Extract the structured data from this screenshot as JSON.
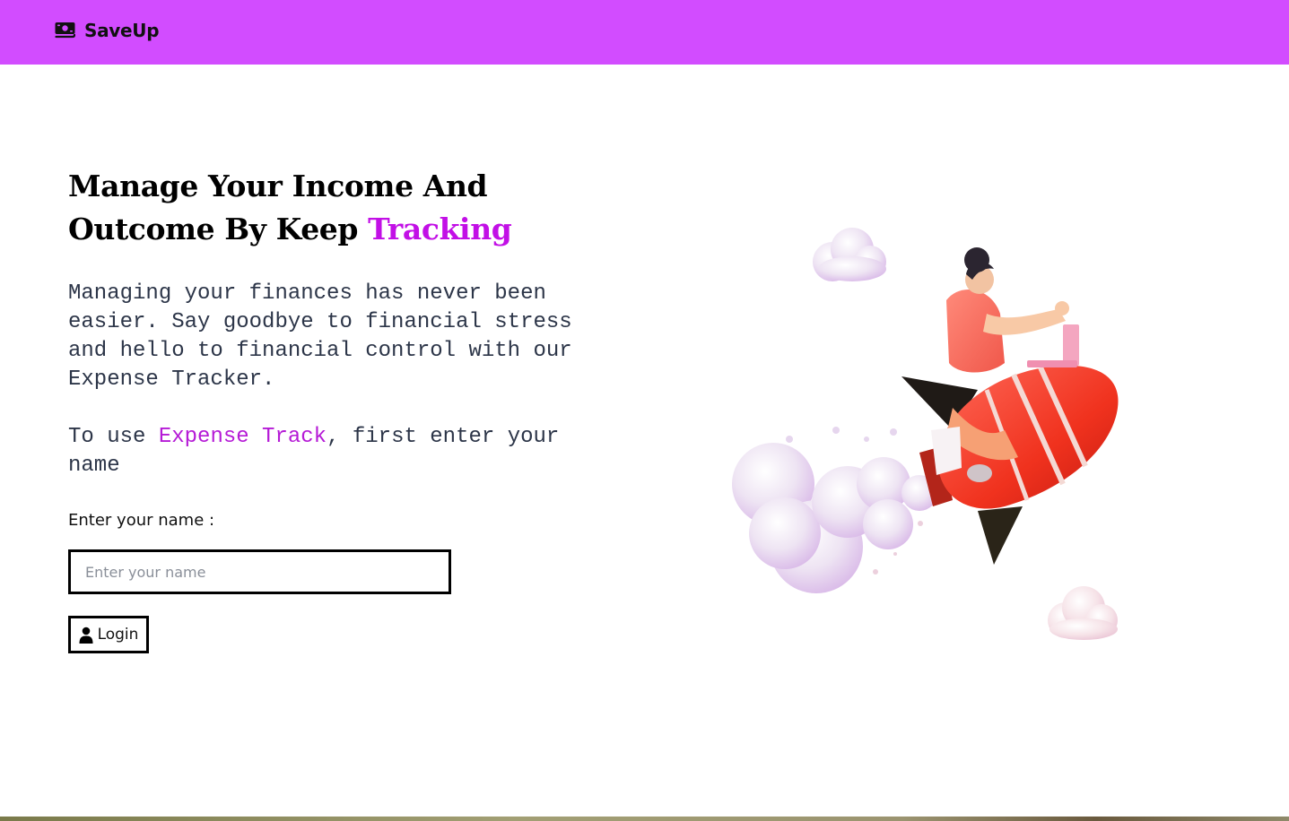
{
  "navbar": {
    "brand_icon": "money-bill-icon",
    "brand_name": "SaveUp",
    "bg_color": "#d24cff"
  },
  "hero": {
    "headline_text": "Manage Your Income And Outcome By Keep",
    "headline_accent": "Tracking",
    "intro": "Managing your finances has never been easier. Say goodbye to financial stress and hello to financial control with our Expense Tracker.",
    "instruction_before": "To use",
    "instruction_accent": "Expense Track",
    "instruction_after": ", first enter your name",
    "accent_color": "#c20fe6"
  },
  "form": {
    "name_label": "Enter your name :",
    "name_placeholder": "Enter your name",
    "name_value": "",
    "login_icon": "user-icon",
    "login_label": "Login"
  },
  "illustration": {
    "subject": "woman-riding-rocket-illustration"
  }
}
